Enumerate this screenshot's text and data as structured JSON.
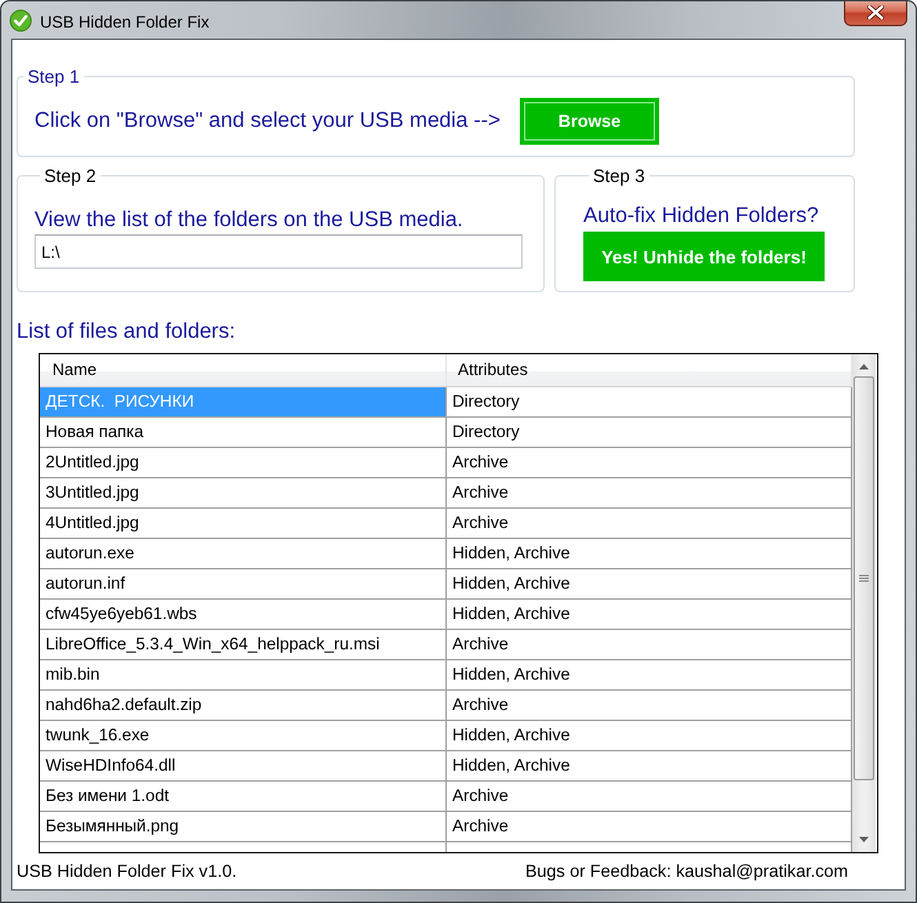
{
  "window": {
    "title": "USB Hidden Folder Fix"
  },
  "step1": {
    "legend": "Step 1",
    "instruction": "Click on \"Browse\" and select your USB media -->",
    "button": "Browse"
  },
  "step2": {
    "legend": "Step 2",
    "instruction": "View the list of the folders on the USB media.",
    "path_field": {
      "value": "L:\\"
    }
  },
  "step3": {
    "legend": "Step 3",
    "instruction": "Auto-fix Hidden Folders?",
    "button": "Yes! Unhide the folders!"
  },
  "list_heading": "List of files and folders:",
  "table": {
    "columns": [
      "Name",
      "Attributes"
    ],
    "rows": [
      {
        "name": "ДЕТСК.  РИСУНКИ",
        "attributes": "Directory",
        "selected": true
      },
      {
        "name": "Новая папка",
        "attributes": "Directory",
        "selected": false
      },
      {
        "name": "2Untitled.jpg",
        "attributes": "Archive",
        "selected": false
      },
      {
        "name": "3Untitled.jpg",
        "attributes": "Archive",
        "selected": false
      },
      {
        "name": "4Untitled.jpg",
        "attributes": "Archive",
        "selected": false
      },
      {
        "name": "autorun.exe",
        "attributes": "Hidden, Archive",
        "selected": false
      },
      {
        "name": "autorun.inf",
        "attributes": "Hidden, Archive",
        "selected": false
      },
      {
        "name": "cfw45ye6yeb61.wbs",
        "attributes": "Hidden, Archive",
        "selected": false
      },
      {
        "name": "LibreOffice_5.3.4_Win_x64_helppack_ru.msi",
        "attributes": "Archive",
        "selected": false
      },
      {
        "name": "mib.bin",
        "attributes": "Hidden, Archive",
        "selected": false
      },
      {
        "name": "nahd6ha2.default.zip",
        "attributes": "Archive",
        "selected": false
      },
      {
        "name": "twunk_16.exe",
        "attributes": "Hidden, Archive",
        "selected": false
      },
      {
        "name": "WiseHDInfo64.dll",
        "attributes": "Hidden, Archive",
        "selected": false
      },
      {
        "name": "Без имени 1.odt",
        "attributes": "Archive",
        "selected": false
      },
      {
        "name": "Безымянный.png",
        "attributes": "Archive",
        "selected": false
      }
    ]
  },
  "status_bar": {
    "version": "USB Hidden Folder Fix v1.0.",
    "feedback": "Bugs or Feedback: kaushal@pratikar.com"
  }
}
